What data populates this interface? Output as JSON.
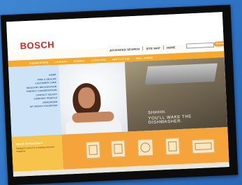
{
  "header": {
    "brand": "BOSCH",
    "links": [
      "ADVANCED SEARCH",
      "SITE MAP",
      "HOME"
    ],
    "search_button": "SEARCH"
  },
  "navbar": {
    "items": [
      "DISHWASHERS",
      "LAUNDRY",
      "RANGES",
      "COOKTOPS",
      "VENTILATION",
      "WALL OVENS"
    ]
  },
  "sidebar": {
    "links": [
      "HOME",
      "FIND A DEALER",
      "CUSTOMER CARE",
      "INDUSTRY RECOGNITION",
      "ENERGY CONSERVATION",
      "CONTACT BOSCH",
      "COMPANY PROFILE",
      "NEWSROOM",
      "MY BOSCH FAVORITES"
    ]
  },
  "promo": {
    "title": "Bosch Dishwashers",
    "text": "Ranked #1 and #2 in a leading consumer magazine"
  },
  "hero": {
    "line1": "SHHHH.",
    "line2": "YOU'LL WAKE THE DISHWASHER."
  },
  "products": [
    "dishwasher-icon",
    "range-icon",
    "washer-icon",
    "refrigerator-icon",
    "cooktop-icon"
  ],
  "colors": {
    "brand_red": "#d8241c",
    "nav_orange": "#f6a92f",
    "sidebar_blue": "#cfe3f7",
    "background_blue": "#3f86d2"
  }
}
